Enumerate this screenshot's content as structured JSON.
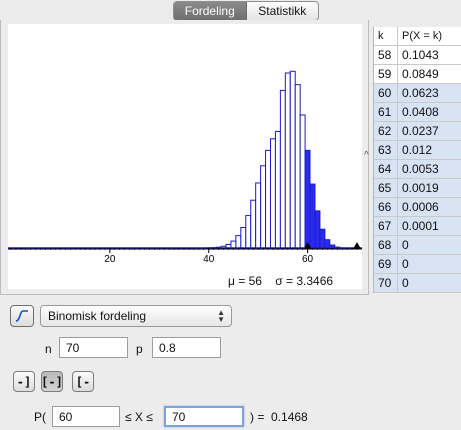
{
  "tabs": [
    {
      "label": "Fordeling",
      "active": true
    },
    {
      "label": "Statistikk",
      "active": false
    }
  ],
  "chart_data": {
    "type": "bar",
    "x": [
      40,
      41,
      42,
      43,
      44,
      45,
      46,
      47,
      48,
      49,
      50,
      51,
      52,
      53,
      54,
      55,
      56,
      57,
      58,
      59,
      60,
      61,
      62,
      63,
      64,
      65,
      66,
      67,
      68,
      69,
      70
    ],
    "values": [
      0.0001,
      0.0002,
      0.0005,
      0.0011,
      0.0023,
      0.0044,
      0.0079,
      0.0131,
      0.0207,
      0.0305,
      0.0415,
      0.0525,
      0.0623,
      0.0697,
      0.0744,
      0.1006,
      0.1117,
      0.1128,
      0.1043,
      0.0849,
      0.0623,
      0.0408,
      0.0237,
      0.012,
      0.0053,
      0.0019,
      0.0006,
      0.0001,
      0,
      0,
      0
    ],
    "highlight_range": [
      60,
      70
    ],
    "xlim": [
      0,
      70
    ],
    "ylim": [
      0,
      0.12
    ],
    "x_ticks": [
      20,
      40,
      60
    ],
    "colors": {
      "bar_fill": "#ffffff",
      "bar_stroke": "#1a1acc",
      "highlight_fill": "#2b2bf0",
      "axis": "#000000"
    }
  },
  "stats": {
    "mu_label": "μ = 56",
    "sigma_label": "σ = 3.3466"
  },
  "table": {
    "headers": {
      "k": "k",
      "p": "P(X = k)"
    },
    "rows": [
      {
        "k": "58",
        "p": "0.1043",
        "selected": false
      },
      {
        "k": "59",
        "p": "0.0849",
        "selected": false
      },
      {
        "k": "60",
        "p": "0.0623",
        "selected": true
      },
      {
        "k": "61",
        "p": "0.0408",
        "selected": true
      },
      {
        "k": "62",
        "p": "0.0237",
        "selected": true
      },
      {
        "k": "63",
        "p": "0.012",
        "selected": true
      },
      {
        "k": "64",
        "p": "0.0053",
        "selected": true
      },
      {
        "k": "65",
        "p": "0.0019",
        "selected": true
      },
      {
        "k": "66",
        "p": "0.0006",
        "selected": true
      },
      {
        "k": "67",
        "p": "0.0001",
        "selected": true
      },
      {
        "k": "68",
        "p": "0",
        "selected": true
      },
      {
        "k": "69",
        "p": "0",
        "selected": true
      },
      {
        "k": "70",
        "p": "0",
        "selected": true
      }
    ]
  },
  "controls": {
    "distribution": "Binomisk fordeling",
    "n_label": "n",
    "n_value": "70",
    "p_label": "p",
    "p_value": "0.8",
    "prob_prefix": "P(",
    "lower_value": "60",
    "le_x_le": "≤ X ≤",
    "upper_value": "70",
    "result": ") =  0.1468",
    "mode_buttons": [
      {
        "icon": "left-sided-icon",
        "glyph": "-]"
      },
      {
        "icon": "interval-icon",
        "glyph": "[-]"
      },
      {
        "icon": "right-sided-icon",
        "glyph": "[-"
      }
    ]
  }
}
